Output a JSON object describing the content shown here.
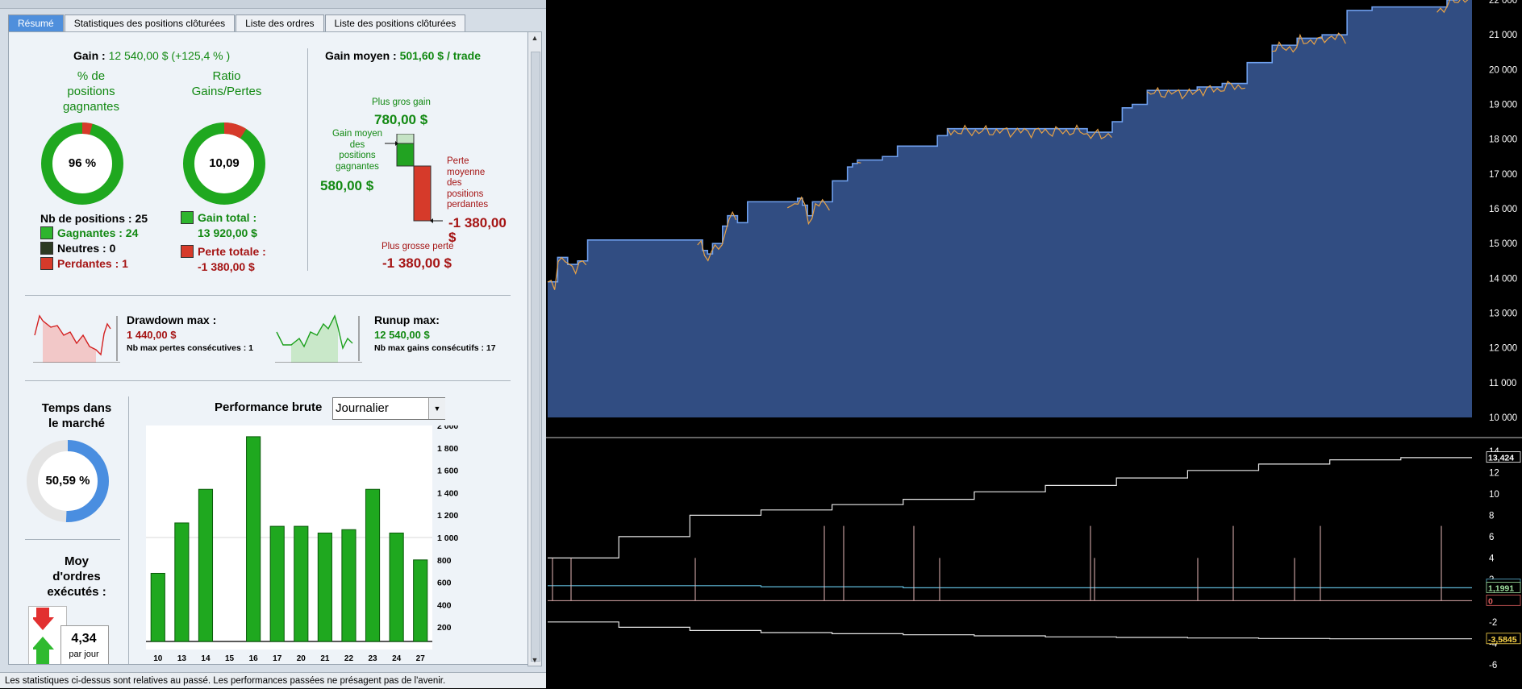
{
  "tabs": [
    {
      "label": "Résumé",
      "active": true
    },
    {
      "label": "Statistiques des positions clôturées",
      "active": false
    },
    {
      "label": "Liste des ordres",
      "active": false
    },
    {
      "label": "Liste des positions clôturées",
      "active": false
    }
  ],
  "summary": {
    "gain_label": "Gain :",
    "gain_value": "12 540,00 $ (+125,4 % )",
    "pct_label": "% de\npositions\ngagnantes",
    "pct_value": "96 %",
    "pct_fraction": 0.96,
    "ratio_label": "Ratio\nGains/Pertes",
    "ratio_value": "10,09",
    "ratio_fraction": 0.91,
    "nb_positions": "Nb de positions : 25",
    "gagnantes": "Gagnantes : 24",
    "neutres": "Neutres : 0",
    "perdantes": "Perdantes : 1",
    "gain_total_label": "Gain total :",
    "gain_total_value": "13 920,00 $",
    "perte_totale_label": "Perte totale :",
    "perte_totale_value": "-1 380,00 $"
  },
  "gain_moyen": {
    "label": "Gain moyen :",
    "value": "501,60 $ / trade",
    "plus_gros_gain_label": "Plus gros gain",
    "plus_gros_gain_value": "780,00 $",
    "gain_moyen_pos_label": "Gain moyen\ndes\npositions\ngagnantes",
    "gain_moyen_pos_value": "580,00 $",
    "perte_moyenne_label": "Perte\nmoyenne\ndes\npositions\nperdantes",
    "perte_moyenne_value": "-1 380,00\n$",
    "plus_grosse_perte_label": "Plus grosse perte",
    "plus_grosse_perte_value": "-1 380,00 $"
  },
  "drawdown": {
    "label": "Drawdown max :",
    "value": "1 440,00 $",
    "sub": "Nb max pertes consécutives : 1"
  },
  "runup": {
    "label": "Runup max:",
    "value": "12 540,00 $",
    "sub": "Nb max gains consécutifs : 17"
  },
  "temps": {
    "label": "Temps dans\nle marché",
    "value": "50,59 %",
    "fraction": 0.5059
  },
  "ordres": {
    "label": "Moy\nd'ordres\nexécutés :",
    "value": "4,34",
    "unit": "par jour"
  },
  "performance": {
    "title": "Performance brute",
    "select_value": "Journalier"
  },
  "chart_data": [
    {
      "type": "bar",
      "title": "Performance brute",
      "categories": [
        "10",
        "13",
        "14",
        "15",
        "16",
        "17",
        "20",
        "21",
        "22",
        "23",
        "24",
        "27"
      ],
      "values": [
        680,
        1130,
        1430,
        60,
        1900,
        1100,
        1100,
        1040,
        1070,
        1430,
        1040,
        800
      ],
      "yticks": [
        "2 000",
        "1 800",
        "1 600",
        "1 400",
        "1 200",
        "1 000",
        "800",
        "600",
        "400",
        "200"
      ],
      "ylim": [
        0,
        2000
      ],
      "color": "#1fa81f"
    },
    {
      "type": "area",
      "yticks": [
        "22 000",
        "21 000",
        "20 000",
        "19 000",
        "18 000",
        "17 000",
        "16 000",
        "15 000",
        "14 000",
        "13 000",
        "12 000",
        "11 000",
        "10 000"
      ],
      "ylim": [
        10000,
        22000
      ],
      "x": [
        0,
        2,
        4,
        6,
        8,
        30,
        31,
        32,
        33,
        35,
        36,
        38,
        40,
        48,
        50,
        51,
        52,
        53,
        57,
        59,
        60,
        61,
        62,
        63,
        67,
        70,
        78,
        80,
        82,
        83,
        84,
        87,
        95,
        105,
        108,
        113,
        115,
        117,
        120,
        125,
        130,
        135,
        140,
        145,
        148,
        150,
        155,
        160,
        165,
        170,
        175,
        178,
        180,
        182,
        185
      ],
      "values": [
        13900,
        14600,
        14400,
        14500,
        15100,
        15100,
        14800,
        14700,
        15000,
        15500,
        15800,
        15600,
        16200,
        16200,
        16300,
        16100,
        15800,
        16200,
        16800,
        16800,
        17200,
        17300,
        17400,
        17400,
        17500,
        17800,
        18100,
        18300,
        18300,
        18300,
        18300,
        18300,
        18300,
        18300,
        18200,
        18500,
        18900,
        19000,
        19400,
        19400,
        19500,
        19600,
        20200,
        20700,
        20700,
        20900,
        21000,
        21700,
        21800,
        21800,
        21800,
        21800,
        22000,
        22100,
        22200
      ],
      "fill": "#314d82"
    },
    {
      "type": "line",
      "yticks": [
        "14",
        "12",
        "10",
        "8",
        "6",
        "4",
        "2",
        "0",
        "-2",
        "-4",
        "-6"
      ],
      "ylim": [
        -7,
        14
      ],
      "series": [
        {
          "values": [
            4,
            6,
            8,
            8.5,
            9,
            9.5,
            10.2,
            10.8,
            11.5,
            12.2,
            12.8,
            13.2,
            13.4
          ],
          "color": "#e8e8e8"
        },
        {
          "values": [
            1.4,
            1.4,
            1.4,
            1.3,
            1.3,
            1.2,
            1.2,
            1.2,
            1.2,
            1.2,
            1.2,
            1.2,
            1.2
          ],
          "color": "#5fb8d8"
        },
        {
          "values": [
            -2,
            -2.5,
            -2.8,
            -3,
            -3.1,
            -3.2,
            -3.3,
            -3.4,
            -3.45,
            -3.5,
            -3.55,
            -3.58,
            -3.58
          ],
          "color": "#e8e8e8"
        }
      ],
      "labels": [
        {
          "text": "13,424",
          "color": "#fff"
        },
        {
          "text": "1,4895",
          "color": "#5fb8d8"
        },
        {
          "text": "1,1991",
          "color": "#9fe09f"
        },
        {
          "text": "0",
          "color": "#e06060"
        },
        {
          "text": "-3,5845",
          "color": "#ffd84a"
        }
      ]
    }
  ],
  "status": "Les statistiques ci-dessus sont relatives au passé. Les performances passées ne présagent pas de l'avenir."
}
